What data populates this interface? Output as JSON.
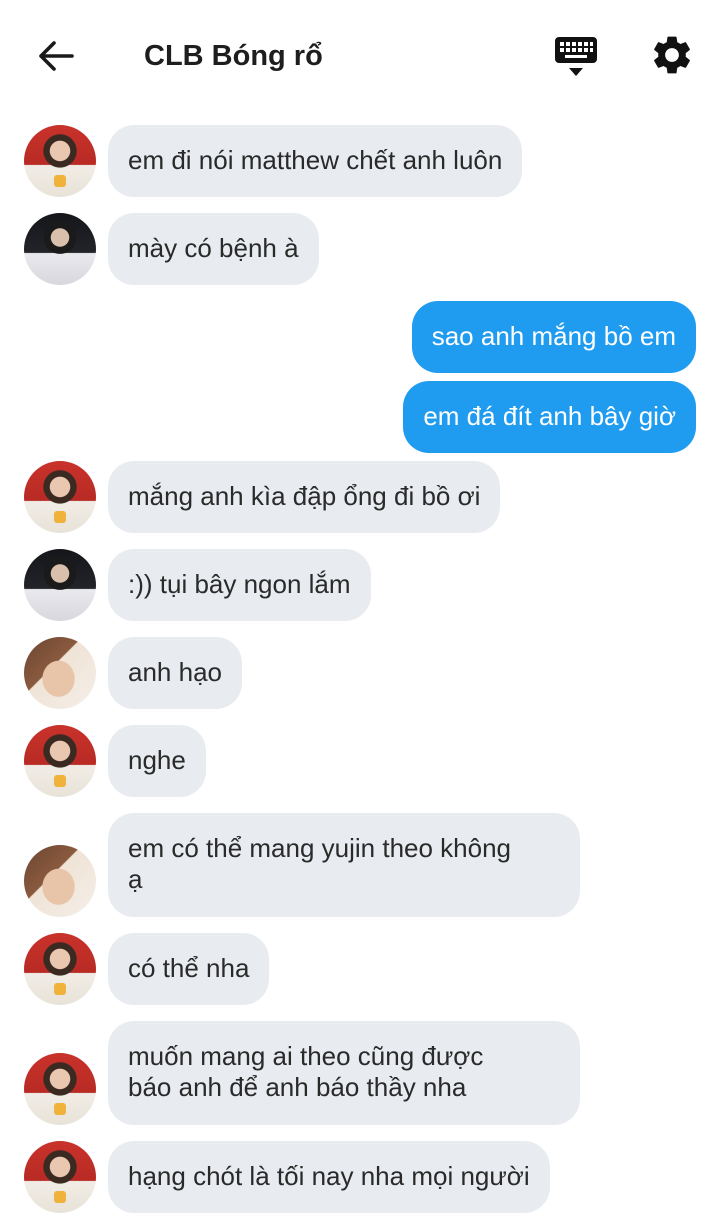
{
  "header": {
    "title": "CLB Bóng rổ",
    "back_icon": "arrow-left-icon",
    "keyboard_icon": "keyboard-icon",
    "settings_icon": "gear-icon"
  },
  "colors": {
    "outgoing_bubble": "#1f9bf0",
    "incoming_bubble": "#e8ebef"
  },
  "messages": [
    {
      "sender": "a",
      "direction": "in",
      "text": "em đi nói matthew chết anh luôn"
    },
    {
      "sender": "b",
      "direction": "in",
      "text": "mày có bệnh à"
    },
    {
      "sender": "me",
      "direction": "out",
      "text": "sao anh mắng bồ em"
    },
    {
      "sender": "me",
      "direction": "out",
      "text": "em đá đít anh bây giờ"
    },
    {
      "sender": "a",
      "direction": "in",
      "text": "mắng anh kìa đập ổng đi bồ ơi"
    },
    {
      "sender": "b",
      "direction": "in",
      "text": ":)) tụi bây ngon lắm"
    },
    {
      "sender": "c",
      "direction": "in",
      "text": "anh hạo"
    },
    {
      "sender": "a",
      "direction": "in",
      "text": "nghe"
    },
    {
      "sender": "c",
      "direction": "in",
      "text": "em có thể mang yujin theo không\nạ"
    },
    {
      "sender": "a",
      "direction": "in",
      "text": "có thể nha"
    },
    {
      "sender": "a",
      "direction": "in",
      "text": "muốn mang ai theo cũng được\nbáo anh để anh báo thầy nha"
    },
    {
      "sender": "a",
      "direction": "in",
      "text": "hạng chót là tối nay nha mọi người"
    }
  ]
}
